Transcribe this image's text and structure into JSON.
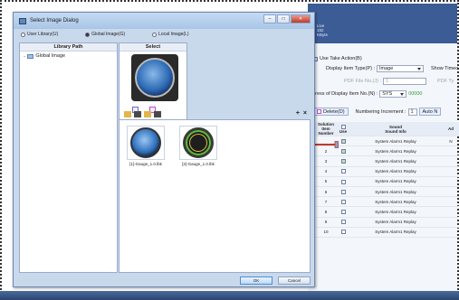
{
  "dialog": {
    "title": "Select Image Dialog",
    "radios": [
      {
        "label": "User Library(U)",
        "selected": false
      },
      {
        "label": "Global Image(G)",
        "selected": true
      },
      {
        "label": "Local Image(L)",
        "selected": false
      }
    ],
    "library_header": "Library Path",
    "library_item": "Global Image",
    "select_header": "Select",
    "images": [
      {
        "label": "[1]-Gauge_1.0.lbk"
      },
      {
        "label": "[2]-Gauge_1.0.lbk"
      }
    ],
    "ok_label": "OK",
    "cancel_label": "Cancel"
  },
  "bgapp": {
    "title_lines": [
      "Live",
      "192",
      "KByte"
    ],
    "use_take_action": "Use Take Action(B)",
    "display_item_type_label": "Display Item Type(P) :",
    "display_item_type_value": "Image",
    "show_timeout": "Show Timeo",
    "pdf_file_no_label": "PDF File No.(J) :",
    "pdf_file_no_value": "1",
    "pdf_short": "PDF Ty",
    "address_label": "ddress of Display Item No.(N) :",
    "address_value": "SYS",
    "address_hex": "00000",
    "delete_label": "Delete(D)",
    "numbering_label": "Numbering Increment :",
    "numbering_value": "1",
    "auto_label": "Auto N",
    "table_headers": {
      "number": "Solution Item Number",
      "use": "Use",
      "sound_group": "Sound",
      "sound_info": "Sound Info",
      "ad": "Ad"
    },
    "rows": [
      {
        "n": "",
        "use": true,
        "info": "System Alarm1 Replay",
        "ad": "N"
      },
      {
        "n": "2",
        "use": true,
        "info": "System Alarm1 Replay",
        "ad": ""
      },
      {
        "n": "3",
        "use": true,
        "info": "System Alarm1 Replay",
        "ad": ""
      },
      {
        "n": "4",
        "use": false,
        "info": "System Alarm1 Replay",
        "ad": ""
      },
      {
        "n": "5",
        "use": false,
        "info": "System Alarm1 Replay",
        "ad": ""
      },
      {
        "n": "6",
        "use": false,
        "info": "System Alarm1 Replay",
        "ad": ""
      },
      {
        "n": "7",
        "use": false,
        "info": "System Alarm1 Replay",
        "ad": ""
      },
      {
        "n": "8",
        "use": false,
        "info": "System Alarm1 Replay",
        "ad": ""
      },
      {
        "n": "9",
        "use": false,
        "info": "System Alarm1 Replay",
        "ad": ""
      },
      {
        "n": "10",
        "use": false,
        "info": "System Alarm1 Replay",
        "ad": ""
      }
    ]
  },
  "colors": {
    "accent": "#3b5c95",
    "arrow": "#c0392b"
  }
}
